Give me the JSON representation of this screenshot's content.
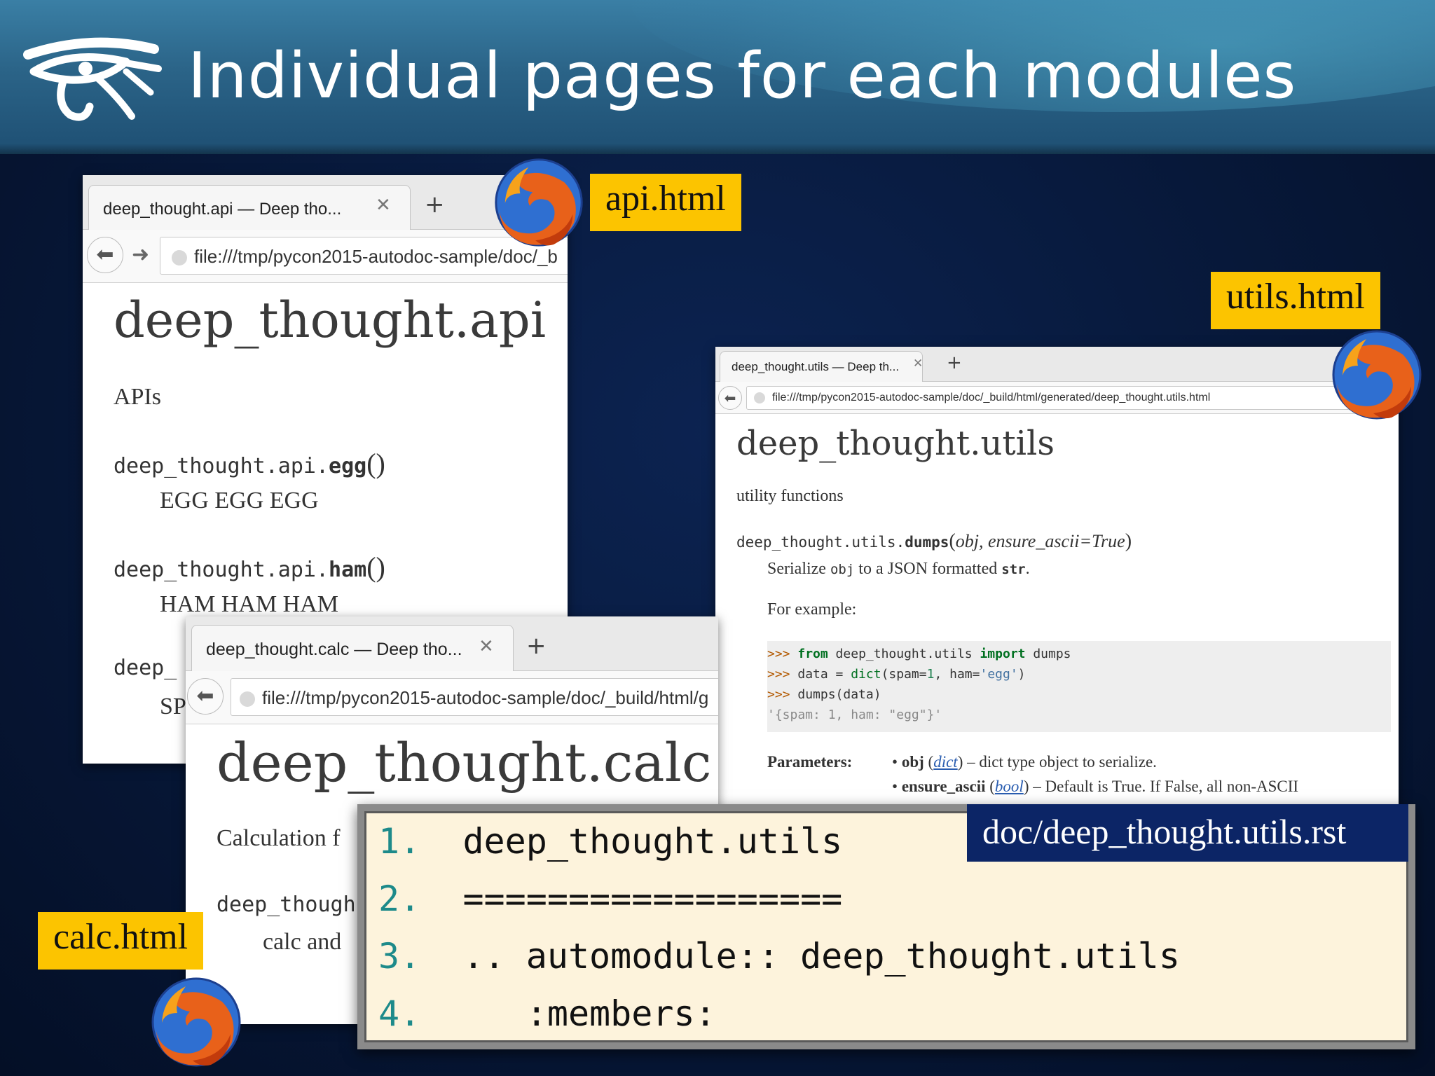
{
  "slide": {
    "title": "Individual pages for each modules"
  },
  "api_window": {
    "tab_title": "deep_thought.api — Deep tho...",
    "url": "file:///tmp/pycon2015-autodoc-sample/doc/_b",
    "heading": "deep_thought.api",
    "description": "APIs",
    "functions": [
      {
        "prefix": "deep_thought.api.",
        "name": "egg",
        "args": "()",
        "doc": "EGG EGG EGG"
      },
      {
        "prefix": "deep_thought.api.",
        "name": "ham",
        "args": "()",
        "doc": "HAM HAM HAM"
      }
    ],
    "partial_func": "deep_",
    "partial_doc": "SP"
  },
  "calc_window": {
    "tab_title": "deep_thought.calc — Deep tho...",
    "url": "file:///tmp/pycon2015-autodoc-sample/doc/_build/html/g",
    "heading": "deep_thought.calc",
    "description": "Calculation f",
    "partial_func": "deep_though",
    "partial_doc": "calc and"
  },
  "utils_window": {
    "tab_title": "deep_thought.utils — Deep th...",
    "url": "file:///tmp/pycon2015-autodoc-sample/doc/_build/html/generated/deep_thought.utils.html",
    "heading": "deep_thought.utils",
    "description": "utility functions",
    "signature": {
      "prefix": "deep_thought.utils.",
      "name": "dumps",
      "params": "obj, ensure_ascii=True"
    },
    "summary_pre": "Serialize",
    "summary_code": "obj",
    "summary_mid": "to a JSON formatted",
    "summary_bold": "str",
    "summary_end": ".",
    "example_label": "For example:",
    "code_lines": [
      {
        "prompt": ">>> ",
        "kw1": "from",
        "t1": " deep_thought.utils ",
        "kw2": "import",
        "t2": " dumps"
      },
      {
        "prompt": ">>> ",
        "t1": "data = ",
        "builtin": "dict",
        "t2": "(spam=",
        "num": "1",
        "t3": ", ham=",
        "str": "'egg'",
        "t4": ")"
      },
      {
        "prompt": ">>> ",
        "t1": "dumps(data)"
      }
    ],
    "code_output": "'{spam: 1, ham: \"egg\"}'",
    "params_label": "Parameters:",
    "params": [
      {
        "name": "obj",
        "type": "dict",
        "desc": "– dict type object to serialize."
      },
      {
        "name": "ensure_ascii",
        "type": "bool",
        "desc": "– Default is True. If False, all non-ASCII"
      }
    ]
  },
  "labels": {
    "api": "api.html",
    "utils": "utils.html",
    "calc": "calc.html",
    "rst": "doc/deep_thought.utils.rst"
  },
  "rst_code": [
    {
      "num": "1.",
      "text": "deep_thought.utils"
    },
    {
      "num": "2.",
      "text": "=================="
    },
    {
      "num": "3.",
      "text": ".. automodule:: deep_thought.utils"
    },
    {
      "num": "4.",
      "text": "   :members:"
    }
  ],
  "colors": {
    "label_bg": "#fcc400",
    "rst_label_bg": "#0c2566",
    "slide_bg": "#071839",
    "header_bg": "#2b6488",
    "code_num": "#1d8a8a",
    "code_bg": "#fdf3dc"
  },
  "icons": {
    "logo": "eye-of-horus-icon",
    "browser": "firefox-icon"
  }
}
